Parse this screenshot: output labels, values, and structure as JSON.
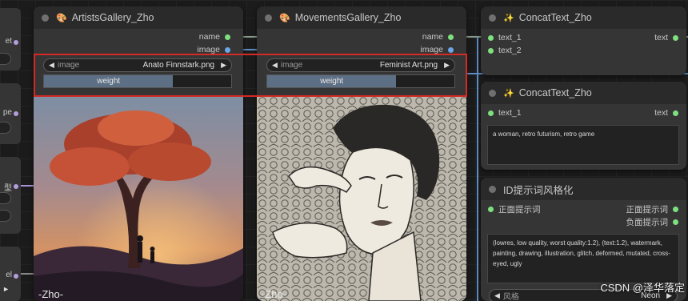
{
  "left_stubs": {
    "labels": [
      "et",
      "pe",
      "型",
      "el"
    ]
  },
  "artists": {
    "title": "ArtistsGallery_Zho",
    "outputs": [
      "name",
      "image"
    ],
    "image_label": "image",
    "image_value": "Anato Finnstark.png",
    "weight_label": "weight",
    "watermark": "-Zho-"
  },
  "movements": {
    "title": "MovementsGallery_Zho",
    "outputs": [
      "name",
      "image"
    ],
    "image_label": "image",
    "image_value": "Feminist Art.png",
    "weight_label": "weight",
    "watermark": "-Zho-"
  },
  "concat1": {
    "title": "ConcatText_Zho",
    "inputs": [
      "text_1",
      "text_2"
    ],
    "output": "text"
  },
  "concat2": {
    "title": "ConcatText_Zho",
    "inputs": [
      "text_1"
    ],
    "output": "text",
    "textbox": "a woman, retro futurism, retro game"
  },
  "idstyle": {
    "title": "ID提示词风格化",
    "input": "正面提示词",
    "outputs": [
      "正面提示词",
      "负面提示词"
    ],
    "negative_text": "(lowres, low quality, worst quality:1.2), (text:1.2), watermark, painting, drawing, illustration, glitch, deformed, mutated, cross-eyed, ugly",
    "style_label": "风格",
    "style_value": "Neon"
  },
  "credit": "CSDN @泽华落定",
  "colors": {
    "highlight": "#d32a23",
    "link_blue": "#6aa6e8",
    "port_green": "#7fe07f"
  }
}
